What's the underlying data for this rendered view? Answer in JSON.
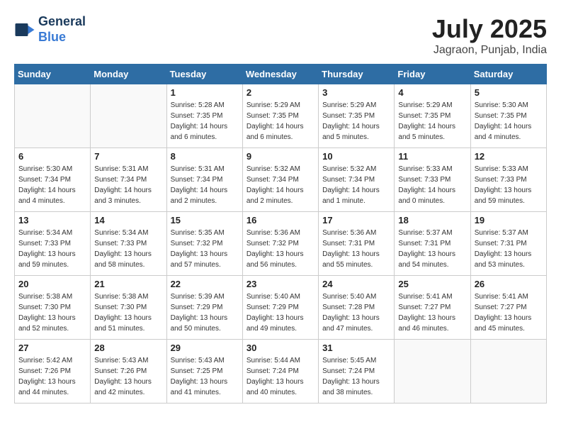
{
  "header": {
    "logo_line1": "General",
    "logo_line2": "Blue",
    "month": "July 2025",
    "location": "Jagraon, Punjab, India"
  },
  "weekdays": [
    "Sunday",
    "Monday",
    "Tuesday",
    "Wednesday",
    "Thursday",
    "Friday",
    "Saturday"
  ],
  "weeks": [
    [
      {
        "day": "",
        "info": ""
      },
      {
        "day": "",
        "info": ""
      },
      {
        "day": "1",
        "info": "Sunrise: 5:28 AM\nSunset: 7:35 PM\nDaylight: 14 hours and 6 minutes."
      },
      {
        "day": "2",
        "info": "Sunrise: 5:29 AM\nSunset: 7:35 PM\nDaylight: 14 hours and 6 minutes."
      },
      {
        "day": "3",
        "info": "Sunrise: 5:29 AM\nSunset: 7:35 PM\nDaylight: 14 hours and 5 minutes."
      },
      {
        "day": "4",
        "info": "Sunrise: 5:29 AM\nSunset: 7:35 PM\nDaylight: 14 hours and 5 minutes."
      },
      {
        "day": "5",
        "info": "Sunrise: 5:30 AM\nSunset: 7:35 PM\nDaylight: 14 hours and 4 minutes."
      }
    ],
    [
      {
        "day": "6",
        "info": "Sunrise: 5:30 AM\nSunset: 7:34 PM\nDaylight: 14 hours and 4 minutes."
      },
      {
        "day": "7",
        "info": "Sunrise: 5:31 AM\nSunset: 7:34 PM\nDaylight: 14 hours and 3 minutes."
      },
      {
        "day": "8",
        "info": "Sunrise: 5:31 AM\nSunset: 7:34 PM\nDaylight: 14 hours and 2 minutes."
      },
      {
        "day": "9",
        "info": "Sunrise: 5:32 AM\nSunset: 7:34 PM\nDaylight: 14 hours and 2 minutes."
      },
      {
        "day": "10",
        "info": "Sunrise: 5:32 AM\nSunset: 7:34 PM\nDaylight: 14 hours and 1 minute."
      },
      {
        "day": "11",
        "info": "Sunrise: 5:33 AM\nSunset: 7:33 PM\nDaylight: 14 hours and 0 minutes."
      },
      {
        "day": "12",
        "info": "Sunrise: 5:33 AM\nSunset: 7:33 PM\nDaylight: 13 hours and 59 minutes."
      }
    ],
    [
      {
        "day": "13",
        "info": "Sunrise: 5:34 AM\nSunset: 7:33 PM\nDaylight: 13 hours and 59 minutes."
      },
      {
        "day": "14",
        "info": "Sunrise: 5:34 AM\nSunset: 7:33 PM\nDaylight: 13 hours and 58 minutes."
      },
      {
        "day": "15",
        "info": "Sunrise: 5:35 AM\nSunset: 7:32 PM\nDaylight: 13 hours and 57 minutes."
      },
      {
        "day": "16",
        "info": "Sunrise: 5:36 AM\nSunset: 7:32 PM\nDaylight: 13 hours and 56 minutes."
      },
      {
        "day": "17",
        "info": "Sunrise: 5:36 AM\nSunset: 7:31 PM\nDaylight: 13 hours and 55 minutes."
      },
      {
        "day": "18",
        "info": "Sunrise: 5:37 AM\nSunset: 7:31 PM\nDaylight: 13 hours and 54 minutes."
      },
      {
        "day": "19",
        "info": "Sunrise: 5:37 AM\nSunset: 7:31 PM\nDaylight: 13 hours and 53 minutes."
      }
    ],
    [
      {
        "day": "20",
        "info": "Sunrise: 5:38 AM\nSunset: 7:30 PM\nDaylight: 13 hours and 52 minutes."
      },
      {
        "day": "21",
        "info": "Sunrise: 5:38 AM\nSunset: 7:30 PM\nDaylight: 13 hours and 51 minutes."
      },
      {
        "day": "22",
        "info": "Sunrise: 5:39 AM\nSunset: 7:29 PM\nDaylight: 13 hours and 50 minutes."
      },
      {
        "day": "23",
        "info": "Sunrise: 5:40 AM\nSunset: 7:29 PM\nDaylight: 13 hours and 49 minutes."
      },
      {
        "day": "24",
        "info": "Sunrise: 5:40 AM\nSunset: 7:28 PM\nDaylight: 13 hours and 47 minutes."
      },
      {
        "day": "25",
        "info": "Sunrise: 5:41 AM\nSunset: 7:27 PM\nDaylight: 13 hours and 46 minutes."
      },
      {
        "day": "26",
        "info": "Sunrise: 5:41 AM\nSunset: 7:27 PM\nDaylight: 13 hours and 45 minutes."
      }
    ],
    [
      {
        "day": "27",
        "info": "Sunrise: 5:42 AM\nSunset: 7:26 PM\nDaylight: 13 hours and 44 minutes."
      },
      {
        "day": "28",
        "info": "Sunrise: 5:43 AM\nSunset: 7:26 PM\nDaylight: 13 hours and 42 minutes."
      },
      {
        "day": "29",
        "info": "Sunrise: 5:43 AM\nSunset: 7:25 PM\nDaylight: 13 hours and 41 minutes."
      },
      {
        "day": "30",
        "info": "Sunrise: 5:44 AM\nSunset: 7:24 PM\nDaylight: 13 hours and 40 minutes."
      },
      {
        "day": "31",
        "info": "Sunrise: 5:45 AM\nSunset: 7:24 PM\nDaylight: 13 hours and 38 minutes."
      },
      {
        "day": "",
        "info": ""
      },
      {
        "day": "",
        "info": ""
      }
    ]
  ]
}
